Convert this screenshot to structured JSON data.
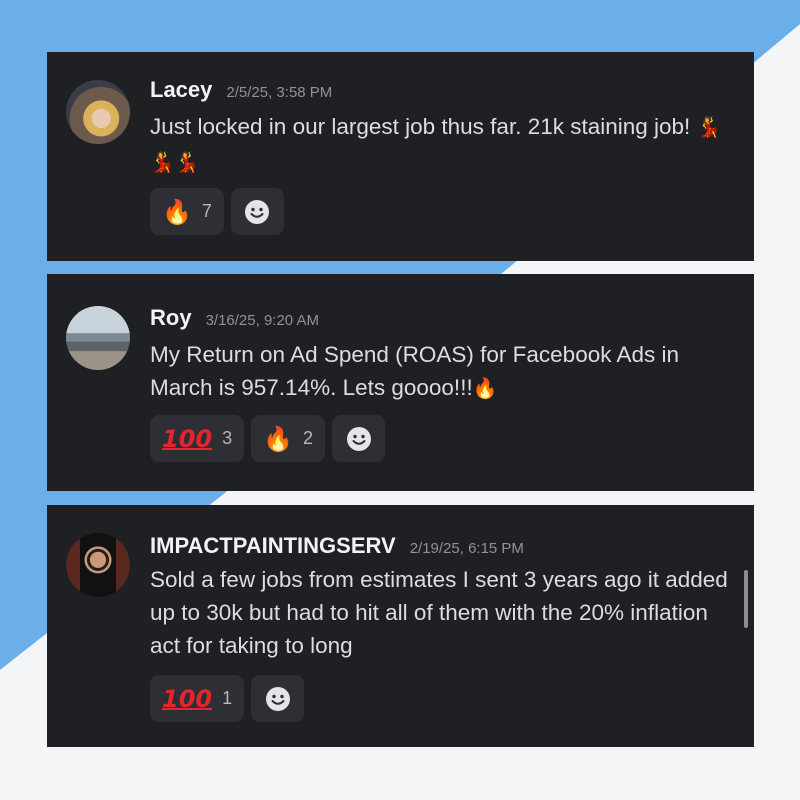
{
  "colors": {
    "card_bg": "#1f2024",
    "accent_blue": "#6aaeea",
    "page_bg": "#f4f5f7",
    "reaction_bg": "#2d2f35"
  },
  "messages": [
    {
      "username": "Lacey",
      "timestamp": "2/5/25, 3:58 PM",
      "text": "Just locked in our largest job thus far. 21k staining job! ",
      "inline_emoji": "💃💃💃",
      "reactions": [
        {
          "emoji": "🔥",
          "icon": "fire-icon",
          "count": "7"
        }
      ]
    },
    {
      "username": "Roy",
      "timestamp": "3/16/25, 9:20 AM",
      "text": "My Return on Ad Spend (ROAS) for Facebook Ads in March is 957.14%. Lets goooo!!!",
      "inline_emoji": "🔥",
      "reactions": [
        {
          "emoji": "100",
          "icon": "hundred-points-icon",
          "count": "3"
        },
        {
          "emoji": "🔥",
          "icon": "fire-icon",
          "count": "2"
        }
      ]
    },
    {
      "username": "IMPACTPAINTINGSERV",
      "timestamp": "2/19/25, 6:15 PM",
      "text": "Sold a few jobs from estimates I sent 3 years ago it added up to 30k but had to hit all of them with the 20% inflation act for taking to long",
      "inline_emoji": "",
      "reactions": [
        {
          "emoji": "100",
          "icon": "hundred-points-icon",
          "count": "1"
        }
      ]
    }
  ]
}
